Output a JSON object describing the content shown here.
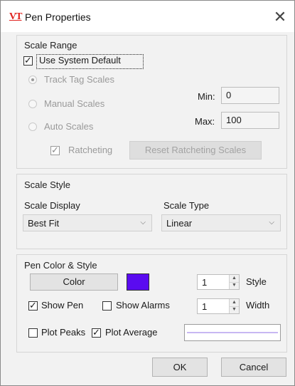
{
  "window": {
    "logo": "VT",
    "title": "Pen Properties",
    "close": "✕"
  },
  "scale_range": {
    "title": "Scale Range",
    "use_system_default": {
      "label": "Use System Default",
      "checked": true
    },
    "options": [
      {
        "label": "Track Tag Scales",
        "selected": true
      },
      {
        "label": "Manual Scales",
        "selected": false
      },
      {
        "label": "Auto Scales",
        "selected": false
      }
    ],
    "min_label": "Min:",
    "min_value": "0",
    "max_label": "Max:",
    "max_value": "100",
    "ratcheting": {
      "label": "Ratcheting",
      "checked": true
    },
    "reset_button": "Reset Ratcheting Scales"
  },
  "scale_style": {
    "title": "Scale Style",
    "display_label": "Scale Display",
    "display_value": "Best Fit",
    "type_label": "Scale Type",
    "type_value": "Linear"
  },
  "pen_color_style": {
    "title": "Pen Color & Style",
    "color_button": "Color",
    "swatch_color": "#5a0bf0",
    "style_value": "1",
    "style_label": "Style",
    "show_pen": {
      "label": "Show Pen",
      "checked": true
    },
    "show_alarms": {
      "label": "Show Alarms",
      "checked": false
    },
    "width_value": "1",
    "width_label": "Width",
    "plot_peaks": {
      "label": "Plot Peaks",
      "checked": false
    },
    "plot_average": {
      "label": "Plot Average",
      "checked": true
    },
    "preview_line_color": "#c7b7f3"
  },
  "footer": {
    "ok": "OK",
    "cancel": "Cancel"
  }
}
